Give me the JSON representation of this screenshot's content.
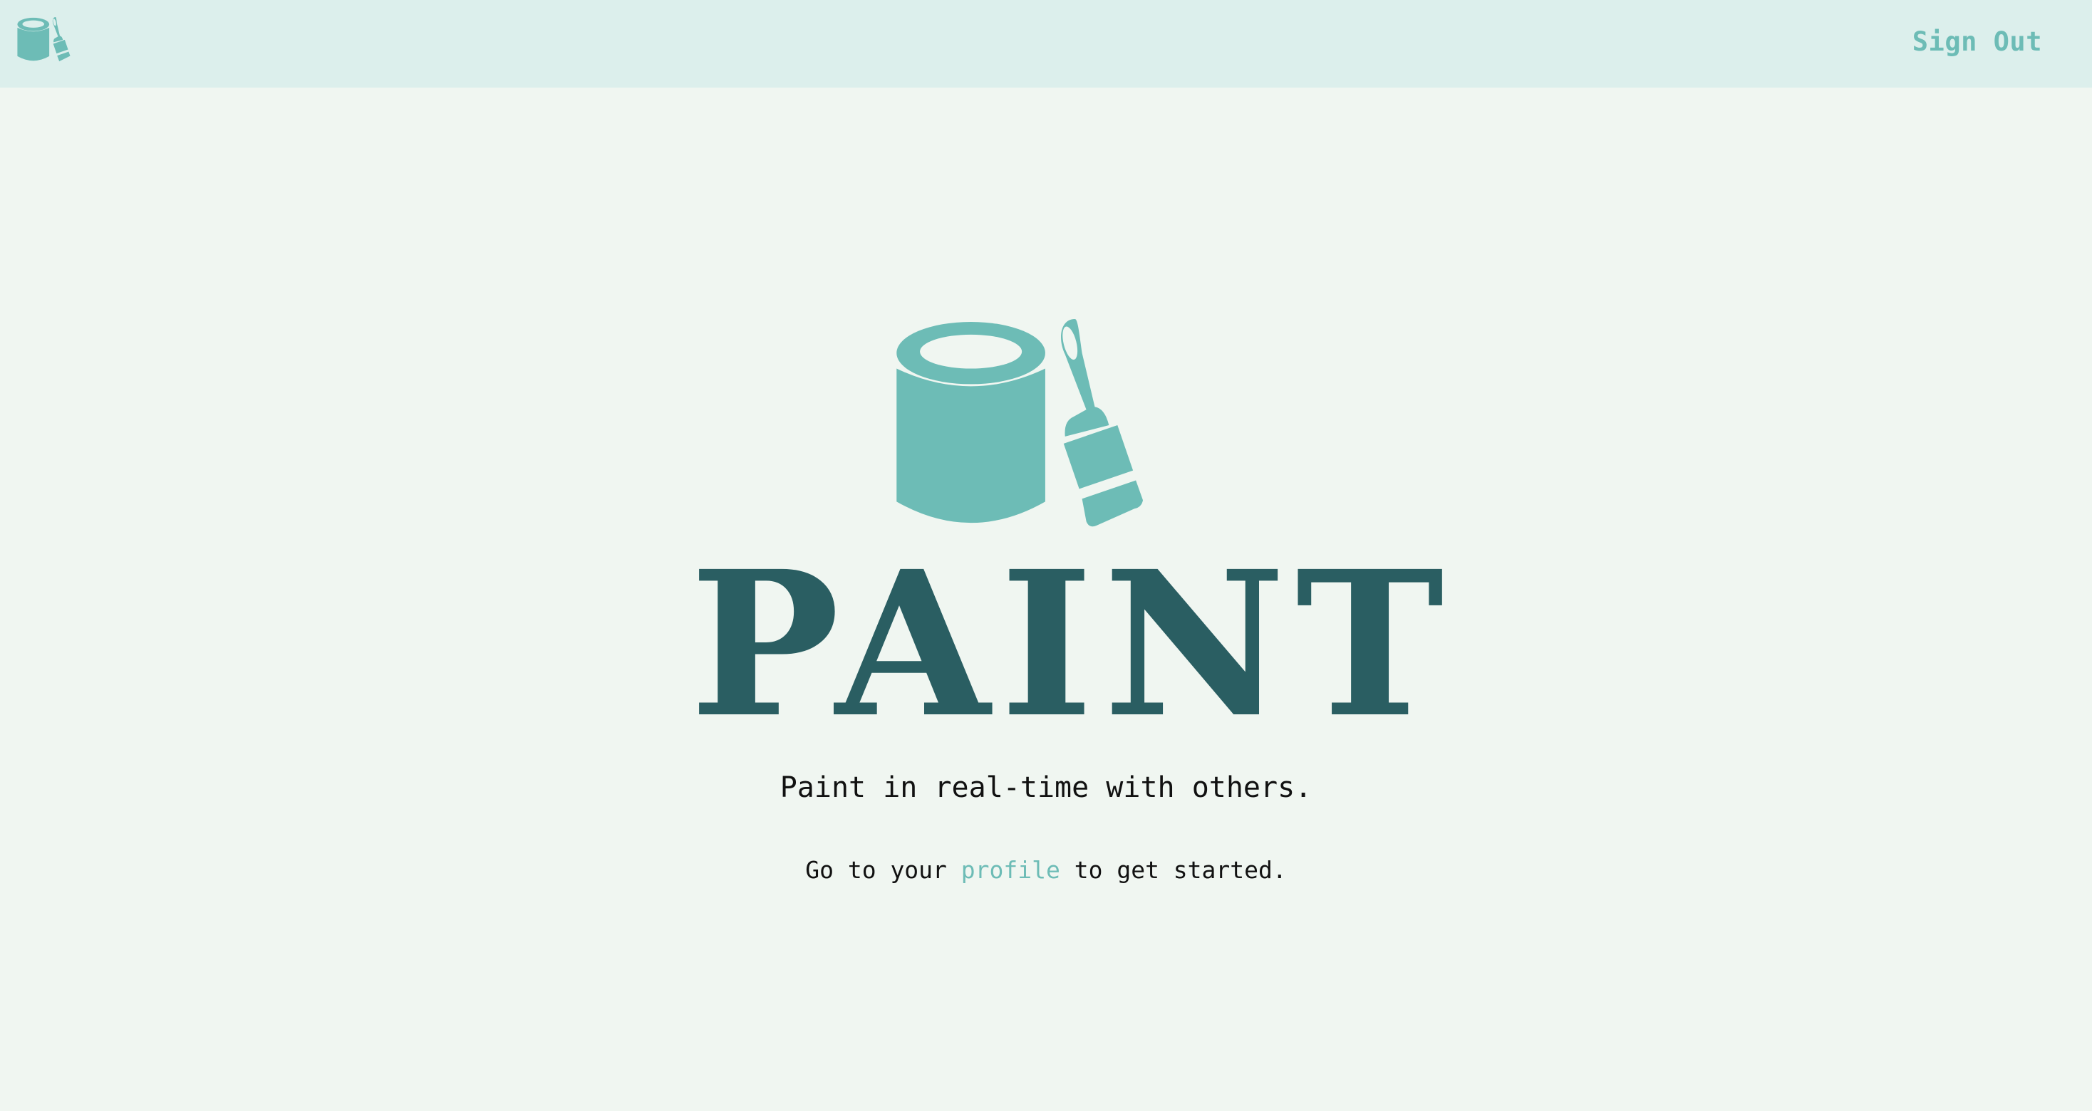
{
  "header": {
    "logo_icon": "paint-can-brush-icon",
    "sign_out_label": "Sign Out"
  },
  "hero": {
    "logo_icon": "paint-can-brush-icon",
    "title": "PAINT",
    "tagline": "Paint in real-time with others.",
    "cta_prefix": "Go to your ",
    "cta_link": "profile",
    "cta_suffix": " to get started."
  },
  "colors": {
    "background": "#f0f6f1",
    "header_background": "#dcefec",
    "accent": "#6dbcb6",
    "title": "#2a5e62",
    "text": "#111111"
  }
}
